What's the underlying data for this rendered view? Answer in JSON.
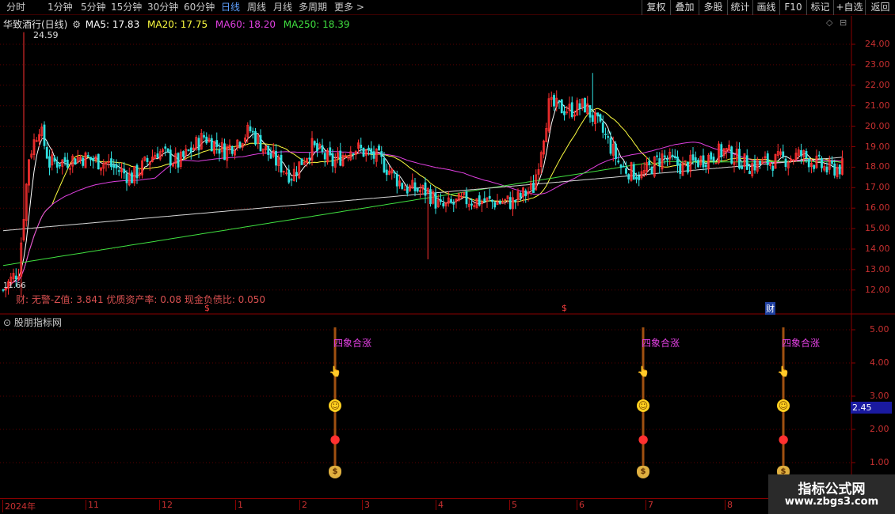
{
  "toolbar": {
    "periods": [
      "分时",
      "1分钟",
      "5分钟",
      "15分钟",
      "30分钟",
      "60分钟",
      "日线",
      "周线",
      "月线",
      "多周期",
      "更多 >"
    ],
    "active_period": "日线",
    "buttons": [
      "复权",
      "叠加",
      "多股",
      "统计",
      "画线",
      "F10",
      "标记",
      "+自选",
      "返回"
    ]
  },
  "main": {
    "stock_name": "华致酒行(日线)",
    "ma": [
      {
        "label": "MA5: 17.83",
        "color": "#ffffff"
      },
      {
        "label": "MA20: 17.75",
        "color": "#ffff40"
      },
      {
        "label": "MA60: 18.20",
        "color": "#e040e0"
      },
      {
        "label": "MA250: 18.39",
        "color": "#40e040"
      }
    ],
    "high_marker": "24.59",
    "low_marker": "11.66",
    "y_ticks": [
      "24.00",
      "23.00",
      "22.00",
      "21.00",
      "20.00",
      "19.00",
      "18.00",
      "17.00",
      "16.00",
      "15.00",
      "14.00",
      "13.00",
      "12.00"
    ],
    "info_line": "财: 无警-Z值: 3.841 优质资产率: 0.08 现金负债比: 0.050",
    "event_tags": [
      {
        "text": "$"
      },
      {
        "text": "$"
      },
      {
        "text": "财"
      }
    ]
  },
  "indicator": {
    "title": "股朋指标网",
    "y_ticks": [
      "5.00",
      "4.00",
      "3.00",
      "2.00",
      "1.00"
    ],
    "current_value": "2.45",
    "signal_label": "四象合涨",
    "icons": [
      "pointing-hand-icon",
      "smiley-icon",
      "red-ball-icon",
      "money-bag-icon"
    ]
  },
  "x_axis": {
    "labels": [
      "2024年",
      "11",
      "12",
      "1",
      "2",
      "3",
      "4",
      "5",
      "6",
      "7",
      "8"
    ]
  },
  "watermark": {
    "title": "指标公式网",
    "url": "www.zbgs3.com"
  },
  "colors": {
    "up": "#ff3030",
    "down": "#30e0e0",
    "grid": "#5a0000",
    "axis_text": "#c83030"
  }
}
